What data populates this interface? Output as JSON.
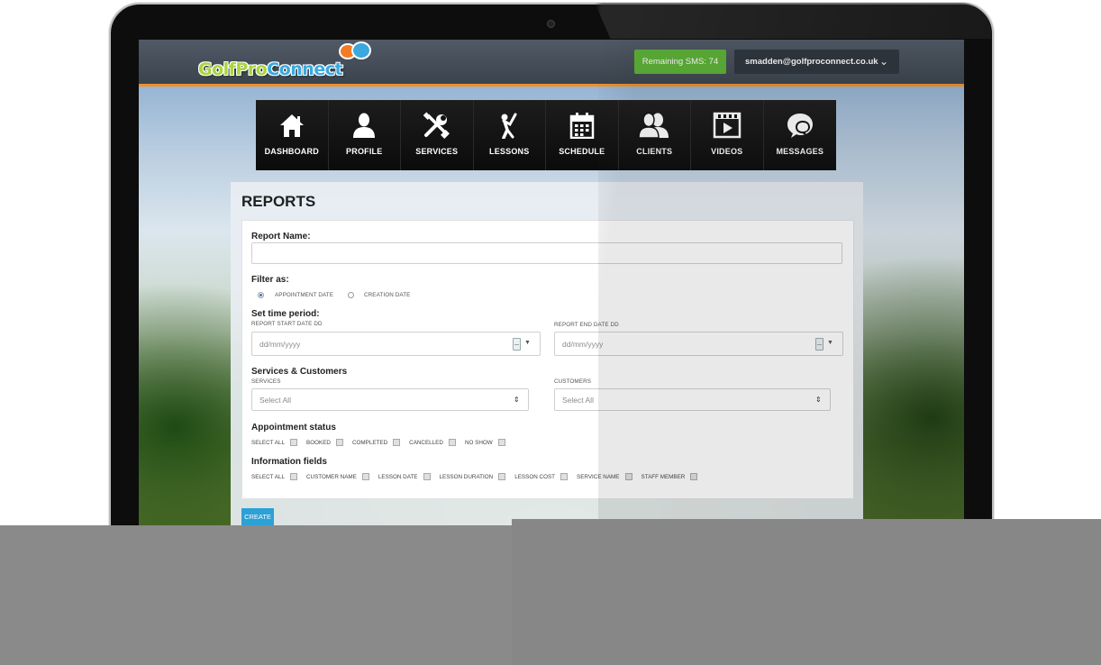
{
  "header": {
    "logo_text_a": "GolfPro",
    "logo_text_b": "Connect",
    "sms_label": "Remaining SMS: 74",
    "user_email": "smadden@golfproconnect.co.uk"
  },
  "nav": {
    "items": [
      {
        "label": "DASHBOARD",
        "icon": "home-icon"
      },
      {
        "label": "PROFILE",
        "icon": "user-icon"
      },
      {
        "label": "SERVICES",
        "icon": "tools-icon"
      },
      {
        "label": "LESSONS",
        "icon": "golfer-icon"
      },
      {
        "label": "SCHEDULE",
        "icon": "calendar-icon"
      },
      {
        "label": "CLIENTS",
        "icon": "users-icon"
      },
      {
        "label": "VIDEOS",
        "icon": "video-icon"
      },
      {
        "label": "MESSAGES",
        "icon": "chat-icon"
      }
    ]
  },
  "reports": {
    "title": "REPORTS",
    "report_name_label": "Report Name:",
    "report_name_value": "",
    "filter_label": "Filter as:",
    "filter_options": [
      "APPOINTMENT DATE",
      "CREATION DATE"
    ],
    "filter_selected": "APPOINTMENT DATE",
    "time_period_label": "Set time period:",
    "start_label": "REPORT START DATE DD",
    "end_label": "REPORT END DATE DD",
    "start_placeholder": "dd/mm/yyyy",
    "end_placeholder": "dd/mm/yyyy",
    "services_customers_label": "Services & Customers",
    "services_label": "SERVICES",
    "customers_label": "CUSTOMERS",
    "services_value": "Select All",
    "customers_value": "Select All",
    "appointment_status_label": "Appointment status",
    "appointment_status_options": [
      "SELECT ALL",
      "BOOKED",
      "COMPLETED",
      "CANCELLED",
      "NO SHOW"
    ],
    "information_fields_label": "Information fields",
    "information_fields_options": [
      "SELECT ALL",
      "CUSTOMER NAME",
      "LESSON DATE",
      "LESSON DURATION",
      "LESSON COST",
      "SERVICE NAME",
      "STAFF MEMBER"
    ],
    "create_label": "CREATE"
  }
}
